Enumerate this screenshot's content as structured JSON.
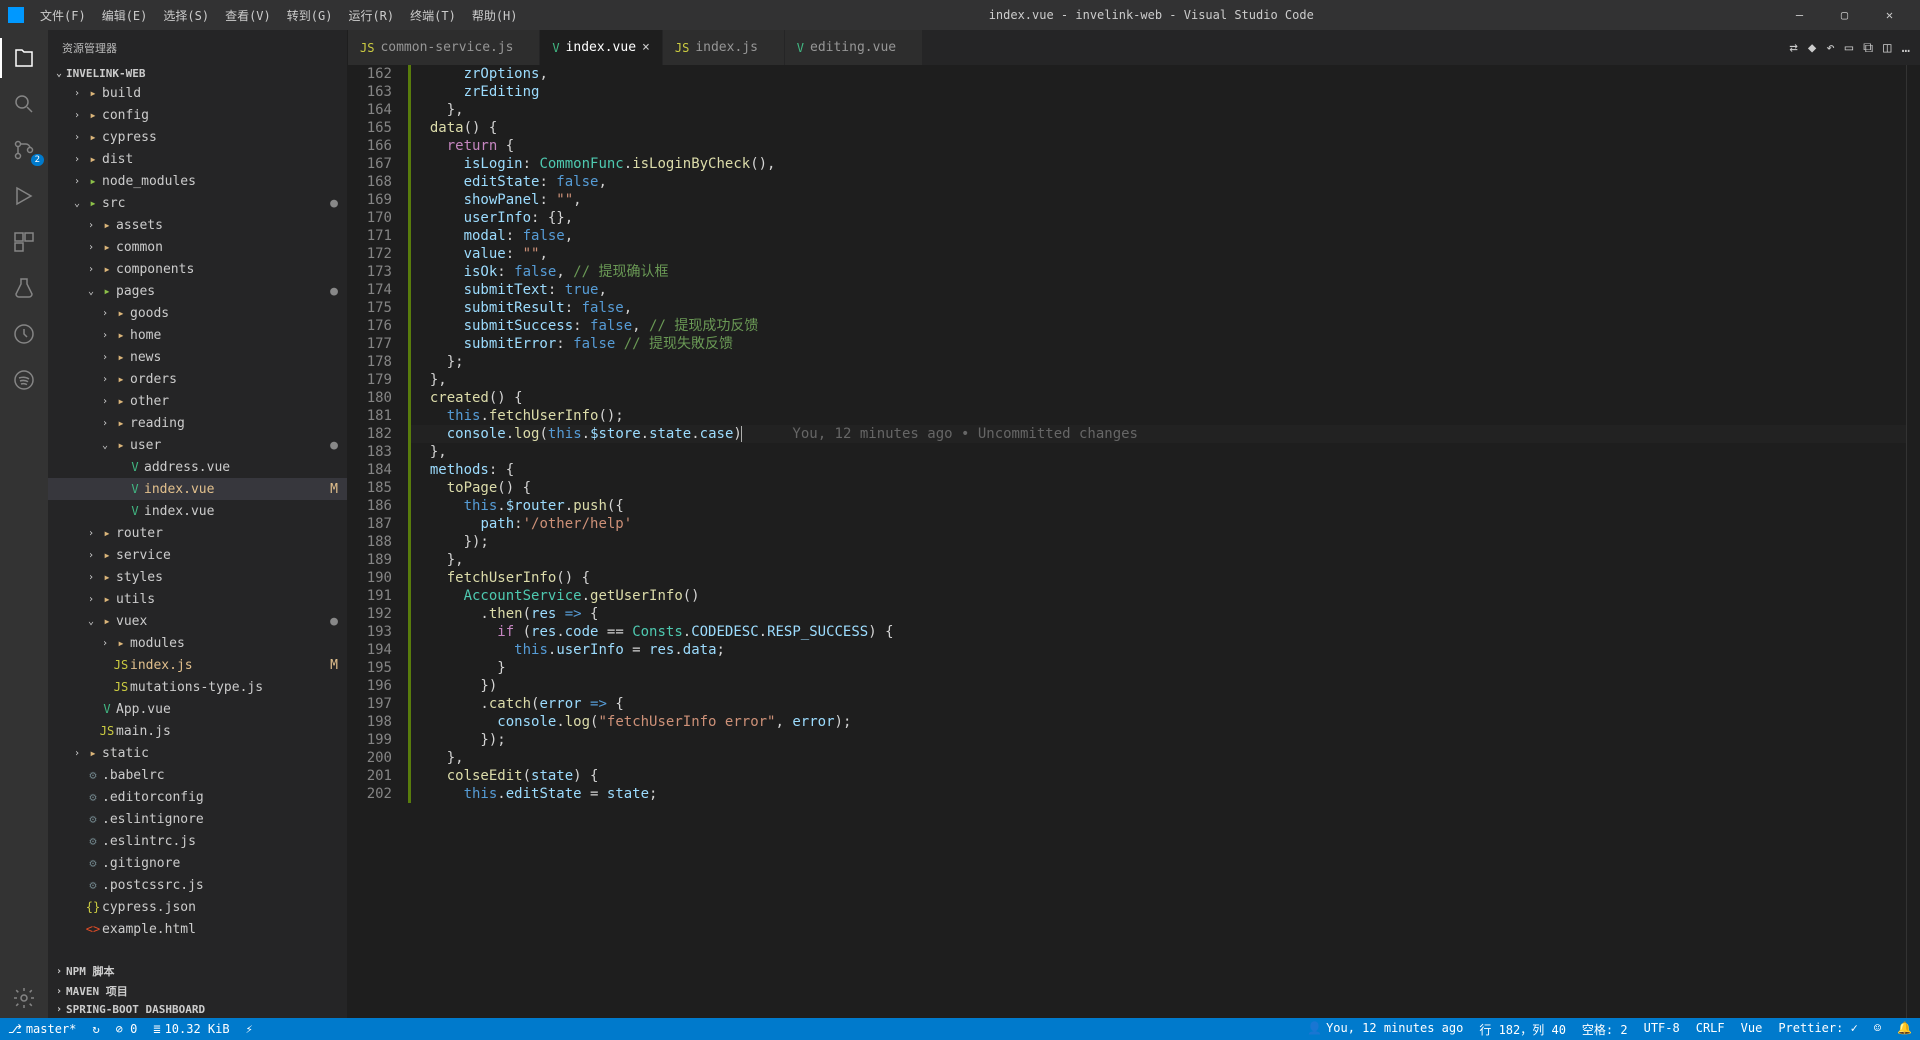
{
  "window": {
    "title": "index.vue - invelink-web - Visual Studio Code"
  },
  "menu": [
    "文件(F)",
    "编辑(E)",
    "选择(S)",
    "查看(V)",
    "转到(G)",
    "运行(R)",
    "终端(T)",
    "帮助(H)"
  ],
  "sidebar_title": "资源管理器",
  "project": "INVELINK-WEB",
  "tree": [
    {
      "d": 1,
      "t": "folder-y",
      "c": ">",
      "l": "build"
    },
    {
      "d": 1,
      "t": "folder-y",
      "c": ">",
      "l": "config"
    },
    {
      "d": 1,
      "t": "folder-y",
      "c": ">",
      "l": "cypress"
    },
    {
      "d": 1,
      "t": "folder-y",
      "c": ">",
      "l": "dist"
    },
    {
      "d": 1,
      "t": "folder-g",
      "c": ">",
      "l": "node_modules"
    },
    {
      "d": 1,
      "t": "folder-g",
      "c": "v",
      "l": "src",
      "s": "●"
    },
    {
      "d": 2,
      "t": "folder-y",
      "c": ">",
      "l": "assets"
    },
    {
      "d": 2,
      "t": "folder-y",
      "c": ">",
      "l": "common"
    },
    {
      "d": 2,
      "t": "folder-y",
      "c": ">",
      "l": "components"
    },
    {
      "d": 2,
      "t": "folder-g",
      "c": "v",
      "l": "pages",
      "s": "●"
    },
    {
      "d": 3,
      "t": "folder-y",
      "c": ">",
      "l": "goods"
    },
    {
      "d": 3,
      "t": "folder-y",
      "c": ">",
      "l": "home"
    },
    {
      "d": 3,
      "t": "folder-y",
      "c": ">",
      "l": "news"
    },
    {
      "d": 3,
      "t": "folder-y",
      "c": ">",
      "l": "orders"
    },
    {
      "d": 3,
      "t": "folder-y",
      "c": ">",
      "l": "other"
    },
    {
      "d": 3,
      "t": "folder-y",
      "c": ">",
      "l": "reading"
    },
    {
      "d": 3,
      "t": "folder-y",
      "c": "v",
      "l": "user",
      "s": "●"
    },
    {
      "d": 4,
      "t": "file-vue",
      "l": "address.vue"
    },
    {
      "d": 4,
      "t": "file-vue",
      "l": "index.vue",
      "s": "M",
      "sel": true,
      "mod": true
    },
    {
      "d": 4,
      "t": "file-vue",
      "l": "index.vue"
    },
    {
      "d": 2,
      "t": "folder-y",
      "c": ">",
      "l": "router"
    },
    {
      "d": 2,
      "t": "folder-y",
      "c": ">",
      "l": "service"
    },
    {
      "d": 2,
      "t": "folder-y",
      "c": ">",
      "l": "styles"
    },
    {
      "d": 2,
      "t": "folder-y",
      "c": ">",
      "l": "utils"
    },
    {
      "d": 2,
      "t": "folder-y",
      "c": "v",
      "l": "vuex",
      "s": "●"
    },
    {
      "d": 3,
      "t": "folder-y",
      "c": ">",
      "l": "modules"
    },
    {
      "d": 3,
      "t": "file-js",
      "l": "index.js",
      "s": "M",
      "mod": true
    },
    {
      "d": 3,
      "t": "file-js",
      "l": "mutations-type.js"
    },
    {
      "d": 2,
      "t": "file-vue",
      "l": "App.vue"
    },
    {
      "d": 2,
      "t": "file-js",
      "l": "main.js"
    },
    {
      "d": 1,
      "t": "folder-y",
      "c": ">",
      "l": "static"
    },
    {
      "d": 1,
      "t": "file-conf",
      "l": ".babelrc"
    },
    {
      "d": 1,
      "t": "file-conf",
      "l": ".editorconfig"
    },
    {
      "d": 1,
      "t": "file-conf",
      "l": ".eslintignore"
    },
    {
      "d": 1,
      "t": "file-conf",
      "l": ".eslintrc.js"
    },
    {
      "d": 1,
      "t": "file-conf",
      "l": ".gitignore"
    },
    {
      "d": 1,
      "t": "file-conf",
      "l": ".postcssrc.js"
    },
    {
      "d": 1,
      "t": "file-json",
      "l": "cypress.json"
    },
    {
      "d": 1,
      "t": "file-ht",
      "l": "example.html"
    }
  ],
  "extra_sections": [
    "NPM 脚本",
    "MAVEN 项目",
    "SPRING-BOOT DASHBOARD"
  ],
  "tabs": [
    {
      "icn": "JS",
      "icnc": "file-js",
      "l": "common-service.js"
    },
    {
      "icn": "V",
      "icnc": "file-vue",
      "l": "index.vue",
      "active": true
    },
    {
      "icn": "JS",
      "icnc": "file-js",
      "l": "index.js"
    },
    {
      "icn": "V",
      "icnc": "file-vue",
      "l": "editing.vue"
    }
  ],
  "scm_badge": "2",
  "code_first_line": 162,
  "code_lines": [
    "      <span class='id'>zrOptions</span>,",
    "      <span class='id'>zrEditing</span>",
    "    },",
    "  <span class='fn'>data</span>() {",
    "    <span class='ctl'>return</span> {",
    "      <span class='id'>isLogin</span>: <span class='typ'>CommonFunc</span>.<span class='fn'>isLoginByCheck</span>(),",
    "      <span class='id'>editState</span>: <span class='bool'>false</span>,",
    "      <span class='id'>showPanel</span>: <span class='str'>\"\"</span>,",
    "      <span class='id'>userInfo</span>: {},",
    "      <span class='id'>modal</span>: <span class='bool'>false</span>,",
    "      <span class='id'>value</span>: <span class='str'>\"\"</span>,",
    "      <span class='id'>isOk</span>: <span class='bool'>false</span>, <span class='cmt'>// 提现确认框</span>",
    "      <span class='id'>submitText</span>: <span class='bool'>true</span>,",
    "      <span class='id'>submitResult</span>: <span class='bool'>false</span>,",
    "      <span class='id'>submitSuccess</span>: <span class='bool'>false</span>, <span class='cmt'>// 提现成功反馈</span>",
    "      <span class='id'>submitError</span>: <span class='bool'>false</span> <span class='cmt'>// 提现失敗反馈</span>",
    "    };",
    "  },",
    "  <span class='fn'>created</span>() {",
    "    <span class='kw'>this</span>.<span class='fn'>fetchUserInfo</span>();",
    "    <span class='id'>console</span>.<span class='fn'>log</span>(<span class='kw'>this</span>.<span class='id'>$store</span>.<span class='id'>state</span>.<span class='id'>case</span>)<span class='cursor'></span>      <span class='ghost'>You, 12 minutes ago • Uncommitted changes</span>",
    "  },",
    "  <span class='id'>methods</span>: {",
    "    <span class='fn'>toPage</span>() {",
    "      <span class='kw'>this</span>.<span class='id'>$router</span>.<span class='fn'>push</span>({",
    "        <span class='id'>path</span>:<span class='str'>'/other/help'</span>",
    "      });",
    "    },",
    "    <span class='fn'>fetchUserInfo</span>() {",
    "      <span class='typ'>AccountService</span>.<span class='fn'>getUserInfo</span>()",
    "        .<span class='fn'>then</span>(<span class='id'>res</span> <span class='kw'>=></span> {",
    "          <span class='ctl'>if</span> (<span class='id'>res</span>.<span class='id'>code</span> == <span class='typ'>Consts</span>.<span class='id'>CODEDESC</span>.<span class='id'>RESP_SUCCESS</span>) {",
    "            <span class='kw'>this</span>.<span class='id'>userInfo</span> = <span class='id'>res</span>.<span class='id'>data</span>;",
    "          }",
    "        })",
    "        .<span class='fn'>catch</span>(<span class='id'>error</span> <span class='kw'>=></span> {",
    "          <span class='id'>console</span>.<span class='fn'>log</span>(<span class='str'>\"fetchUserInfo error\"</span>, <span class='id'>error</span>);",
    "        });",
    "    },",
    "    <span class='fn'>colseEdit</span>(<span class='id'>state</span>) {",
    "      <span class='kw'>this</span>.<span class='id'>editState</span> = <span class='id'>state</span>;"
  ],
  "status": {
    "branch": "master*",
    "sync": "↻",
    "errors": "⊘ 0",
    "size": "10.32 KiB",
    "bolt": "⚡",
    "blame": "You, 12 minutes ago",
    "pos": "行 182，列 40",
    "spaces": "空格: 2",
    "encoding": "UTF-8",
    "eol": "CRLF",
    "lang": "Vue",
    "prettier": "Prettier: ✓",
    "bell": "🔔",
    "feedback": "☺"
  }
}
